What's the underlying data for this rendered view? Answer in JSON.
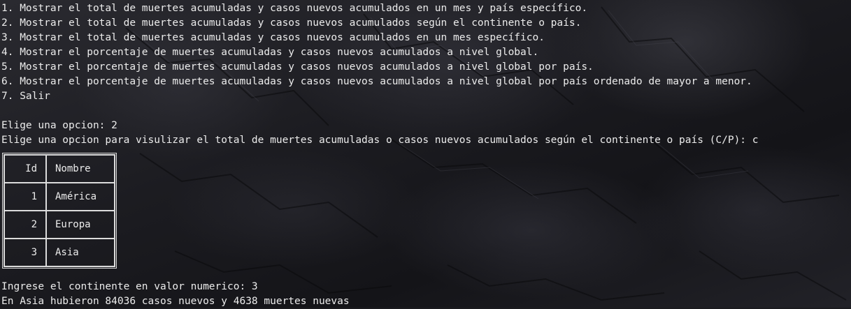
{
  "menu": [
    "1. Mostrar el total de muertes acumuladas y casos nuevos acumulados en un mes y país específico.",
    "2. Mostrar el total de muertes acumuladas y casos nuevos acumulados según el continente o país.",
    "3. Mostrar el total de muertes acumuladas y casos nuevos acumulados en un mes específico.",
    "4. Mostrar el porcentaje de muertes acumuladas y casos nuevos acumulados a nivel global.",
    "5. Mostrar el porcentaje de muertes acumuladas y casos nuevos acumulados a nivel global por país.",
    "6. Mostrar el porcentaje de muertes acumuladas y casos nuevos acumulados a nivel global por país ordenado de mayor a menor.",
    "7. Salir"
  ],
  "prompts": {
    "option": "Elige una opcion: 2",
    "view_choice": "Elige una opcion para visulizar el total de muertes acumuladas o casos nuevos acumulados según el continente o país (C/P): c",
    "continent_input": "Ingrese el continente en valor numerico: 3",
    "result": "En Asia hubieron 84036 casos nuevos y 4638 muertes nuevas"
  },
  "table": {
    "headers": {
      "id": "Id",
      "name": "Nombre"
    },
    "rows": [
      {
        "id": "1",
        "name": "América"
      },
      {
        "id": "2",
        "name": "Europa"
      },
      {
        "id": "3",
        "name": "Asia"
      }
    ]
  }
}
